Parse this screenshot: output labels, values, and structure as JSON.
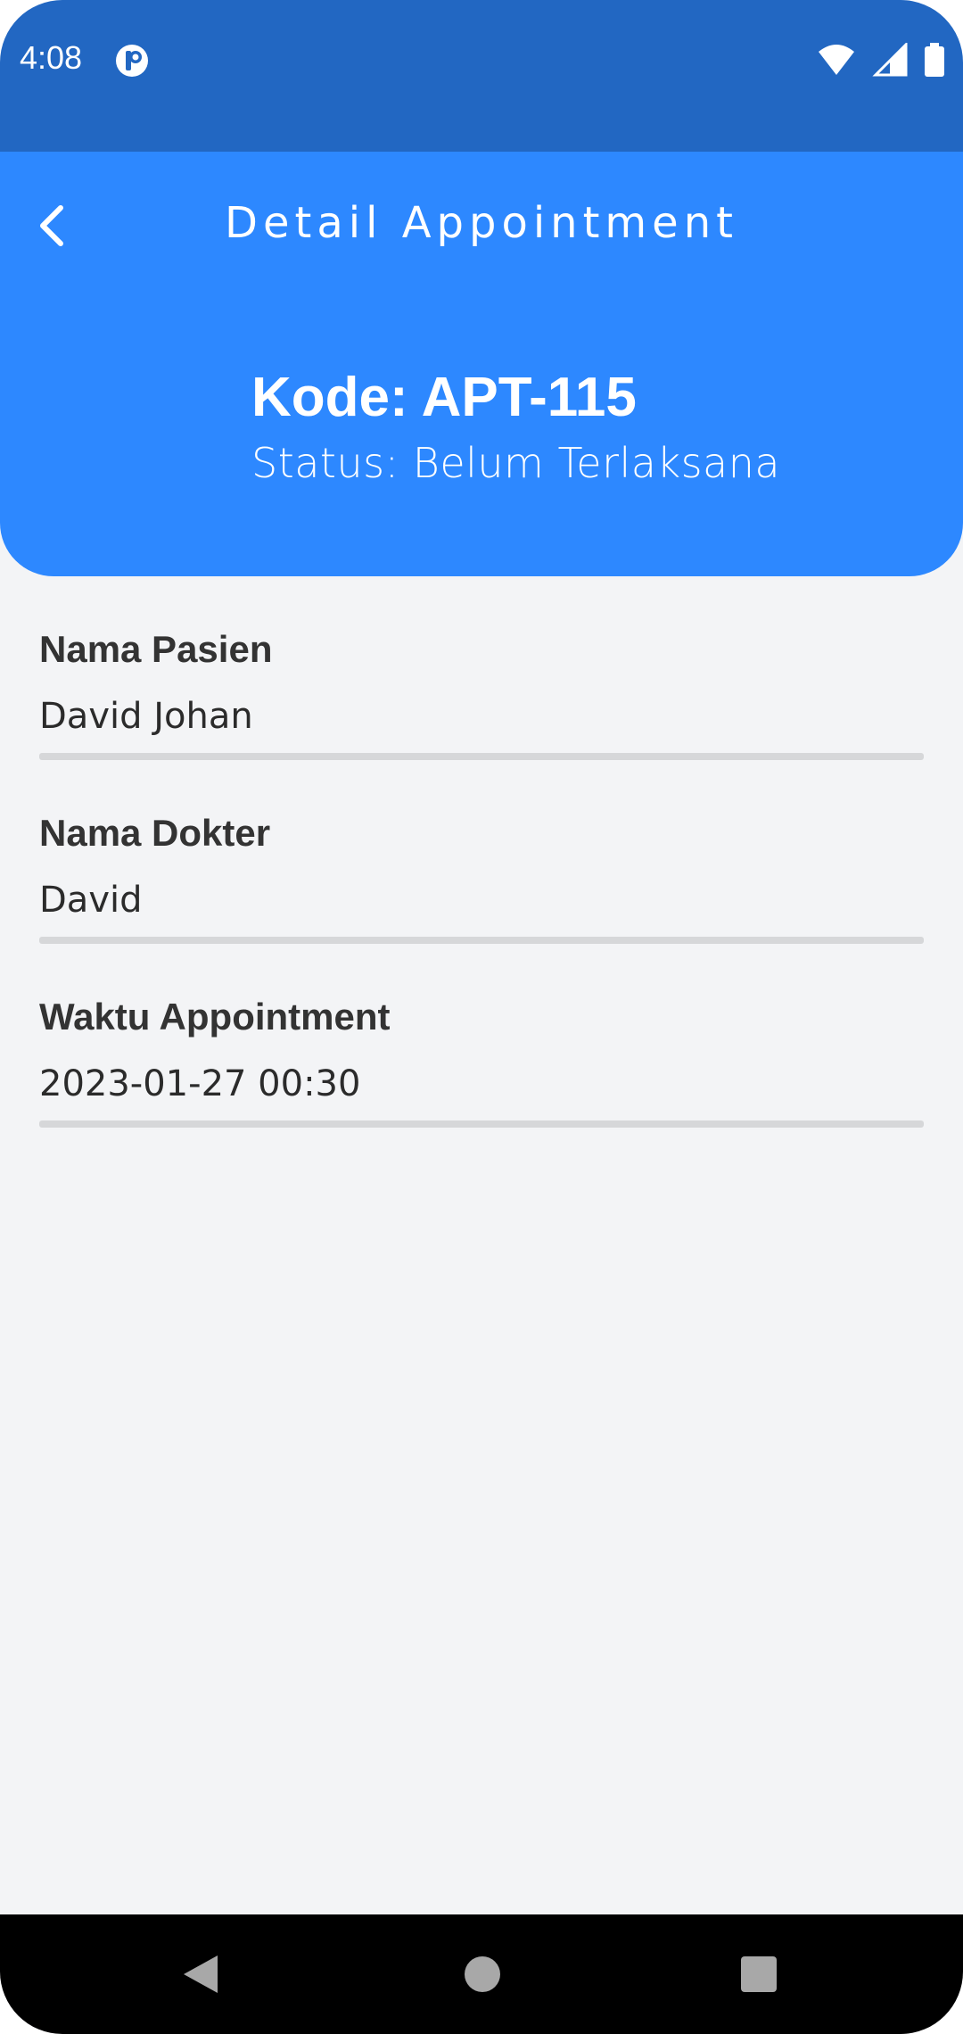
{
  "status_bar": {
    "time": "4:08",
    "app_icon": "circle-p-icon",
    "wifi_icon": "wifi-icon",
    "signal_icon": "signal-icon",
    "battery_icon": "battery-icon"
  },
  "header": {
    "title": "Detail Appointment",
    "back_icon": "chevron-left-icon",
    "code": "Kode: APT-115",
    "status": "Status: Belum Terlaksana",
    "background_color": "#2d88ff"
  },
  "fields": [
    {
      "label": "Nama Pasien",
      "value": "David Johan"
    },
    {
      "label": "Nama Dokter",
      "value": "David"
    },
    {
      "label": "Waktu Appointment",
      "value": "2023-01-27 00:30"
    }
  ],
  "nav_bar": {
    "back": "triangle-back-icon",
    "home": "circle-home-icon",
    "recents": "square-recents-icon"
  }
}
